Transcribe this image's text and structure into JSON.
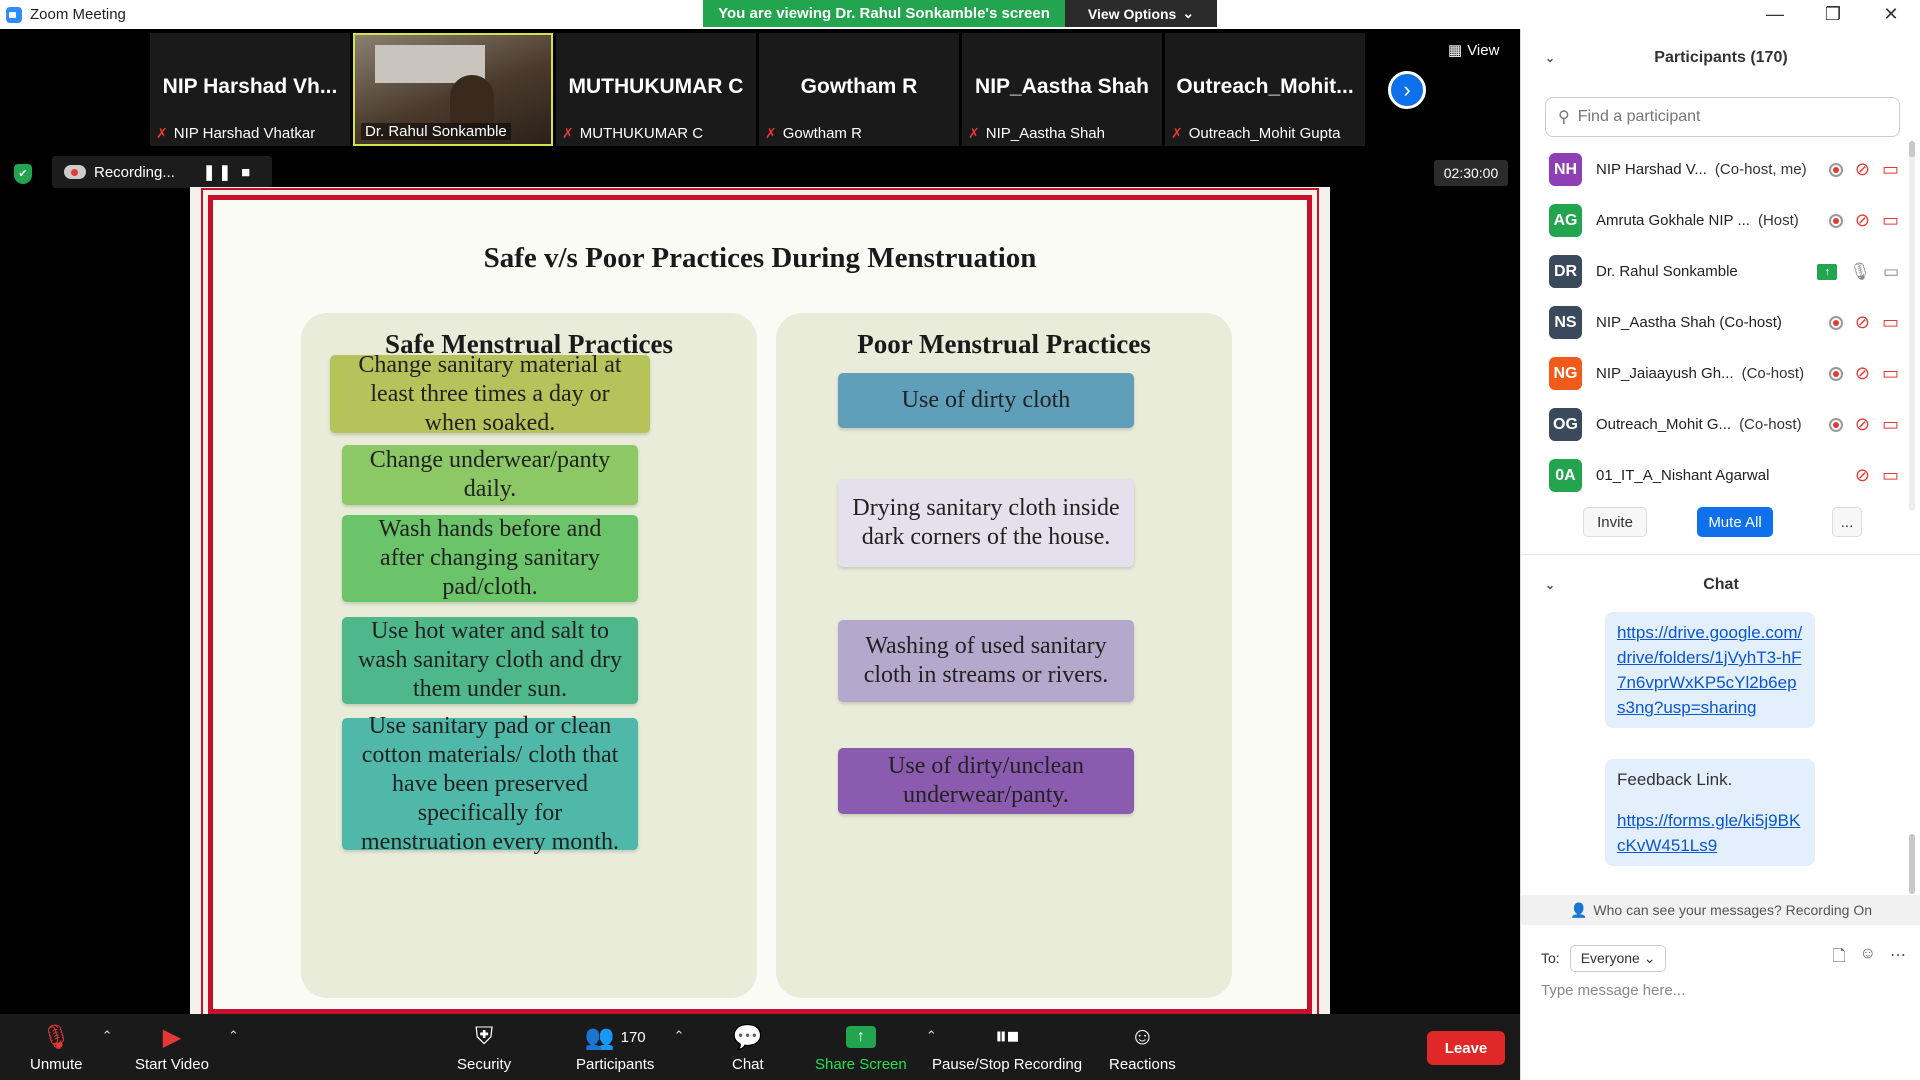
{
  "window": {
    "title": "Zoom Meeting",
    "minimize": "—",
    "restore": "❐",
    "close": "✕"
  },
  "banner": {
    "viewing_text": "You are viewing Dr. Rahul Sonkamble's screen",
    "view_options": "View Options",
    "view_options_caret": "⌄"
  },
  "strip": {
    "tiles": [
      {
        "big": "NIP  Harshad  Vh...",
        "small": "NIP Harshad Vhatkar"
      },
      {
        "big": "",
        "small": "Dr. Rahul Sonkamble"
      },
      {
        "big": "MUTHUKUMAR C",
        "small": "MUTHUKUMAR C"
      },
      {
        "big": "Gowtham R",
        "small": "Gowtham R"
      },
      {
        "big": "NIP_Aastha Shah",
        "small": "NIP_Aastha Shah"
      },
      {
        "big": "Outreach_Mohit...",
        "small": "Outreach_Mohit Gupta"
      }
    ],
    "next_icon": "›",
    "view_label": "View",
    "view_icon": "▦"
  },
  "recording": {
    "label": "Recording...",
    "controls": "❚❚ ■",
    "timer": "02:30:00",
    "shield_icon": "✔"
  },
  "slide": {
    "title": "Safe v/s Poor Practices During Menstruation",
    "safe_heading": "Safe Menstrual Practices",
    "poor_heading": "Poor Menstrual Practices",
    "safe": [
      "Change sanitary material at least three times a day or when soaked.",
      "Change underwear/panty daily.",
      "Wash hands before and after changing sanitary pad/cloth.",
      "Use hot water and salt to wash sanitary cloth and dry them under sun.",
      "Use sanitary pad or clean cotton materials/ cloth that have been preserved specifically for menstruation every month."
    ],
    "poor": [
      "Use of dirty cloth",
      "Drying sanitary cloth inside dark corners of the house.",
      "Washing of used sanitary cloth in streams or rivers.",
      "Use of dirty/unclean underwear/panty."
    ],
    "colors": {
      "safe": [
        "#b5c35a",
        "#8cc865",
        "#6cc46a",
        "#4fb88a",
        "#4fb8a8"
      ],
      "poor": [
        "#5f9fba",
        "#e4e0ec",
        "#b4a8cc",
        "#8a5bae"
      ]
    }
  },
  "participants": {
    "header": "Participants (170)",
    "search_placeholder": "Find a participant",
    "list": [
      {
        "initials": "NH",
        "color": "#8e3fb5",
        "name": "NIP Harshad V...",
        "role": "(Co-host, me)",
        "rec": true,
        "mic": "muted",
        "video": "off"
      },
      {
        "initials": "AG",
        "color": "#23a550",
        "name": "Amruta Gokhale NIP ...",
        "role": "(Host)",
        "rec": true,
        "mic": "muted",
        "video": "off"
      },
      {
        "initials": "DR",
        "color": "#3a4a5c",
        "name": "Dr. Rahul Sonkamble",
        "role": "",
        "rec": false,
        "mic": "on",
        "video": "on-grey",
        "share": true
      },
      {
        "initials": "NS",
        "color": "#3a4a5c",
        "name": "NIP_Aastha Shah (Co-host)",
        "role": "",
        "rec": true,
        "mic": "muted",
        "video": "off"
      },
      {
        "initials": "NG",
        "color": "#f05a1a",
        "name": "NIP_Jaiaayush Gh...",
        "role": "(Co-host)",
        "rec": true,
        "mic": "muted",
        "video": "off"
      },
      {
        "initials": "OG",
        "color": "#3a4a5c",
        "name": "Outreach_Mohit G...",
        "role": "(Co-host)",
        "rec": true,
        "mic": "muted",
        "video": "off"
      },
      {
        "initials": "0A",
        "color": "#23a550",
        "name": "01_IT_A_Nishant Agarwal",
        "role": "",
        "rec": false,
        "mic": "muted",
        "video": "off"
      }
    ],
    "invite": "Invite",
    "mute_all": "Mute All",
    "more": "..."
  },
  "chat": {
    "header": "Chat",
    "messages": [
      {
        "link": "https://drive.google.com/drive/folders/1jVyhT3-hF7n6vprWxKP5cYl2b6eps3ng?usp=sharing"
      },
      {
        "text": "Feedback Link.",
        "link": "https://forms.gle/ki5j9BKcKvW451Ls9"
      }
    ],
    "who_can_see": "Who can see your messages? Recording On",
    "to_label": "To:",
    "to_value": "Everyone",
    "placeholder": "Type message here..."
  },
  "toolbar": {
    "unmute": "Unmute",
    "start_video": "Start Video",
    "security": "Security",
    "participants": "Participants",
    "participants_count": "170",
    "chat": "Chat",
    "share_screen": "Share Screen",
    "pause_stop": "Pause/Stop Recording",
    "reactions": "Reactions",
    "leave": "Leave"
  }
}
